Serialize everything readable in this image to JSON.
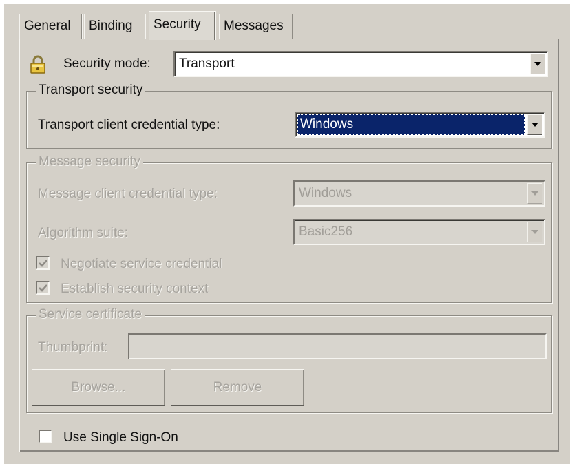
{
  "tabs": [
    "General",
    "Binding",
    "Security",
    "Messages"
  ],
  "security_mode": {
    "label": "Security mode:",
    "value": "Transport"
  },
  "transport_security": {
    "title": "Transport security",
    "credential_label": "Transport client credential type:",
    "credential_value": "Windows"
  },
  "message_security": {
    "title": "Message security",
    "credential_label": "Message client credential type:",
    "credential_value": "Windows",
    "algorithm_label": "Algorithm suite:",
    "algorithm_value": "Basic256",
    "negotiate_label": "Negotiate service credential",
    "negotiate_checked": true,
    "establish_label": "Establish security context",
    "establish_checked": true
  },
  "service_certificate": {
    "title": "Service certificate",
    "thumbprint_label": "Thumbprint:",
    "thumbprint_value": "",
    "browse_label": "Browse...",
    "remove_label": "Remove"
  },
  "sso": {
    "label": "Use Single Sign-On",
    "checked": false
  }
}
